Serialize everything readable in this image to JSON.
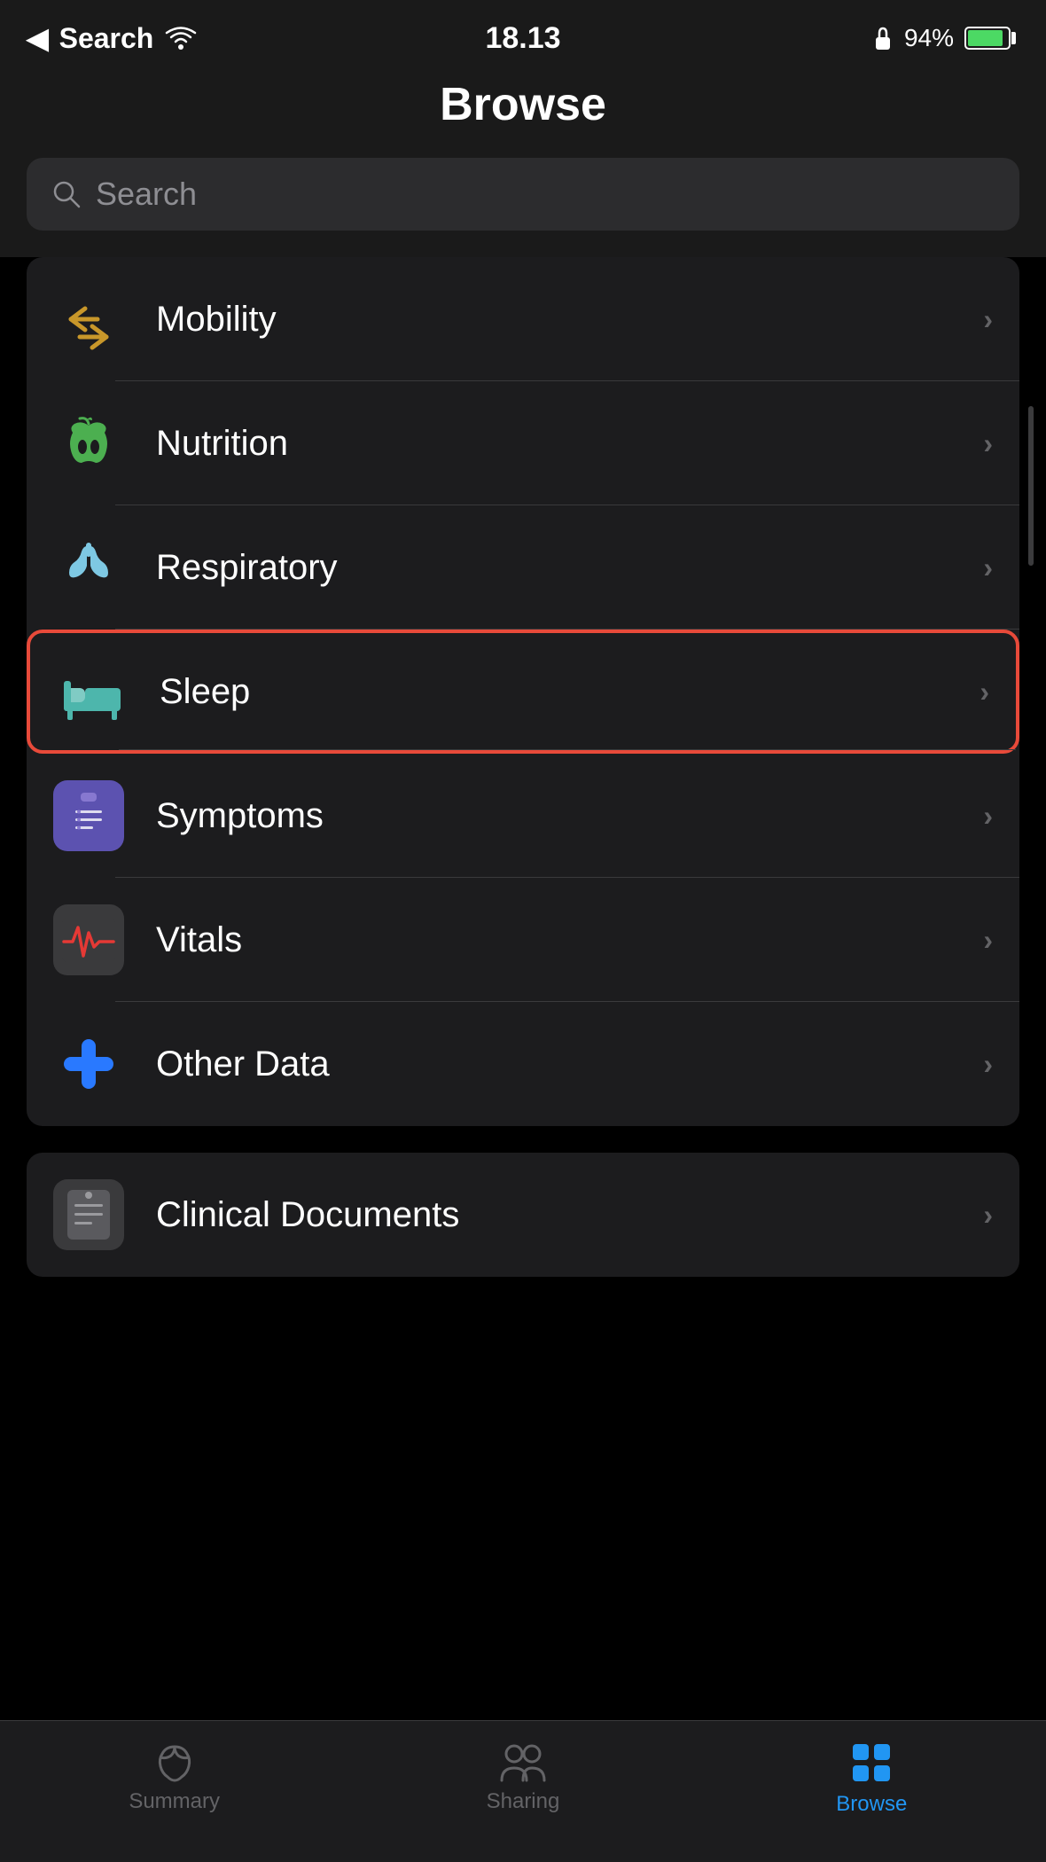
{
  "statusBar": {
    "back": "Search",
    "time": "18.13",
    "batteryPercent": "94%",
    "lockIcon": "🔒"
  },
  "header": {
    "title": "Browse"
  },
  "search": {
    "placeholder": "Search"
  },
  "listItems": [
    {
      "id": "mobility",
      "label": "Mobility",
      "iconType": "mobility",
      "highlighted": false
    },
    {
      "id": "nutrition",
      "label": "Nutrition",
      "iconType": "nutrition",
      "highlighted": false
    },
    {
      "id": "respiratory",
      "label": "Respiratory",
      "iconType": "respiratory",
      "highlighted": false
    },
    {
      "id": "sleep",
      "label": "Sleep",
      "iconType": "sleep",
      "highlighted": true
    },
    {
      "id": "symptoms",
      "label": "Symptoms",
      "iconType": "symptoms",
      "highlighted": false
    },
    {
      "id": "vitals",
      "label": "Vitals",
      "iconType": "vitals",
      "highlighted": false
    },
    {
      "id": "other-data",
      "label": "Other Data",
      "iconType": "other",
      "highlighted": false
    }
  ],
  "clinicalDocuments": {
    "label": "Clinical Documents"
  },
  "tabBar": {
    "summary": "Summary",
    "sharing": "Sharing",
    "browse": "Browse"
  },
  "colors": {
    "accent": "#2196f3",
    "highlight": "#e84a3a",
    "inactive": "#636366"
  }
}
